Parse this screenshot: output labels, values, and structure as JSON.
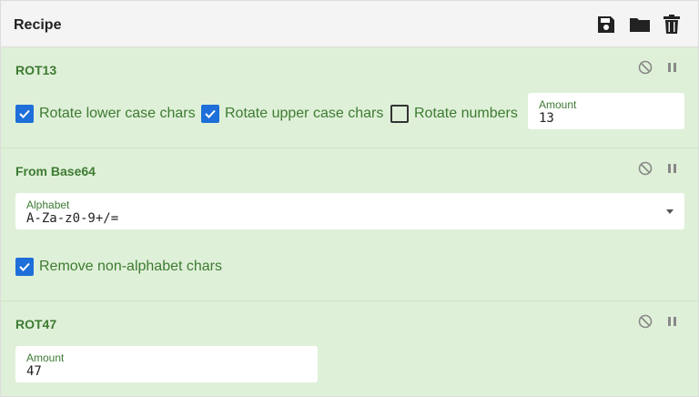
{
  "header": {
    "title": "Recipe",
    "icons": [
      "save-icon",
      "folder-icon",
      "trash-icon"
    ]
  },
  "operations": {
    "rot13": {
      "title": "ROT13",
      "checkboxes": [
        {
          "label": "Rotate lower case chars",
          "checked": true
        },
        {
          "label": "Rotate upper case chars",
          "checked": true
        },
        {
          "label": "Rotate numbers",
          "checked": false
        }
      ],
      "amount_label": "Amount",
      "amount_value": "13"
    },
    "from_base64": {
      "title": "From Base64",
      "alphabet_label": "Alphabet",
      "alphabet_value": "A-Za-z0-9+/=",
      "checkbox_label": "Remove non-alphabet chars",
      "checkbox_checked": true
    },
    "rot47": {
      "title": "ROT47",
      "amount_label": "Amount",
      "amount_value": "47"
    }
  },
  "colors": {
    "op_background": "#dff0d8",
    "label_green": "#3d7b32",
    "checkbox_blue": "#1e6fd9",
    "header_background": "#f4f4f4"
  }
}
